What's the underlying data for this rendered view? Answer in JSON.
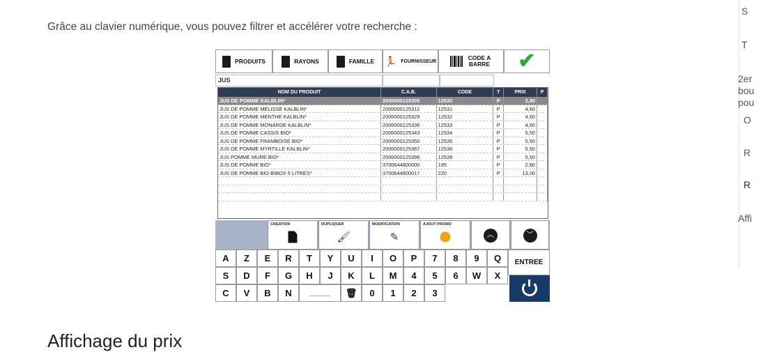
{
  "article": {
    "intro": "Grâce au clavier numérique, vous pouvez filtrer et accélérer votre recherche :",
    "next_heading": "Affichage du prix"
  },
  "right_rail": [
    "S",
    "T",
    "2er",
    "bou",
    "pou",
    "O",
    "R",
    "R",
    "Affi"
  ],
  "app": {
    "toolbar": {
      "produits": "PRODUITS",
      "rayons": "RAYONS",
      "famille": "FAMILLE",
      "fournisseur": "FOURNISSEUR",
      "code_barre": "CODE A BARRE",
      "validate_icon": "check-icon"
    },
    "search_value": "JUS",
    "columns": [
      "NOM DU PRODUIT",
      "C.A.B.",
      "CODE",
      "T",
      "PRIX",
      "P"
    ],
    "rows": [
      {
        "name": "JUS DE POMME KALBLIN*",
        "cab": "2000000125305",
        "code": "12530",
        "t": "P",
        "prix": "2,90"
      },
      {
        "name": "JUS DE POMME MELISSE KALBLIN*",
        "cab": "2000000125312",
        "code": "12531",
        "t": "P",
        "prix": "4,60"
      },
      {
        "name": "JUS DE POMME MENTHE KALBLIN*",
        "cab": "2000000125329",
        "code": "12532",
        "t": "P",
        "prix": "4,60"
      },
      {
        "name": "JUS DE POMME MONARDE KALBLIN*",
        "cab": "2000000125336",
        "code": "12533",
        "t": "P",
        "prix": "4,60"
      },
      {
        "name": "JUS DE POMME CASSIS BIO*",
        "cab": "2000000125343",
        "code": "12534",
        "t": "P",
        "prix": "5,50"
      },
      {
        "name": "JUS DE POMME FRAMBOISE BIO*",
        "cab": "2000000125350",
        "code": "12535",
        "t": "P",
        "prix": "5,50"
      },
      {
        "name": "JUS DE POMME MYRTILLE KALBLIN*",
        "cab": "2000000125367",
        "code": "12536",
        "t": "P",
        "prix": "5,50"
      },
      {
        "name": "JUS POMME MURE BIO*",
        "cab": "2000000125398",
        "code": "12539",
        "t": "P",
        "prix": "5,50"
      },
      {
        "name": "JUS DE POMME BIO*",
        "cab": "3700644800000",
        "code": "195",
        "t": "P",
        "prix": "2,80"
      },
      {
        "name": "JUS DE POMME BIO BIBOX 5 LITRES*",
        "cab": "3700644800017",
        "code": "220",
        "t": "P",
        "prix": "13,00"
      }
    ],
    "actions": {
      "creation": "CREATION",
      "dupliquer": "DUPLIQUER",
      "modification": "MODIFICATION",
      "ajout_promo": "AJOUT PROMO",
      "promo_color": "#f2a01a"
    },
    "keyboard": [
      [
        "A",
        "Z",
        "E",
        "R",
        "T",
        "Y",
        "U",
        "I",
        "O",
        "P",
        "7",
        "8",
        "9"
      ],
      [
        "Q",
        "S",
        "D",
        "F",
        "G",
        "H",
        "J",
        "K",
        "L",
        "M",
        "4",
        "5",
        "6"
      ],
      [
        "W",
        "X",
        "C",
        "V",
        "B",
        "N",
        "______",
        "🗑",
        "0",
        "1",
        "2",
        "3"
      ]
    ],
    "entree": "ENTREE"
  }
}
